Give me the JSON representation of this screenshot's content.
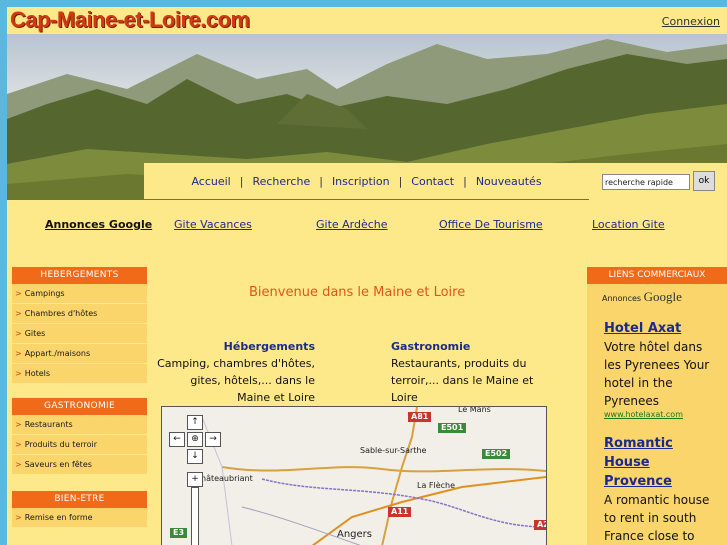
{
  "header": {
    "logo": "Cap-Maine-et-Loire.com",
    "login": "Connexion"
  },
  "nav": {
    "items": [
      "Accueil",
      "Recherche",
      "Inscription",
      "Contact",
      "Nouveautés"
    ],
    "separator": "|"
  },
  "search": {
    "placeholder": "recherche rapide",
    "button": "ok"
  },
  "google_links": {
    "label": "Annonces Google",
    "links": [
      "Gite Vacances",
      "Gite Ardèche",
      "Office De Tourisme",
      "Location Gite"
    ]
  },
  "sidebar": {
    "hebergements": {
      "title": "HEBERGEMENTS",
      "items": [
        "Campings",
        "Chambres d'hôtes",
        "Gites",
        "Appart./maisons",
        "Hotels"
      ]
    },
    "gastronomie": {
      "title": "GASTRONOMIE",
      "items": [
        "Restaurants",
        "Produits du terroir",
        "Saveurs en fêtes"
      ]
    },
    "bienetre": {
      "title": "BIEN-ETRE",
      "items": [
        "Remise en forme"
      ]
    },
    "arrow": ">"
  },
  "main": {
    "welcome": "Bienvenue dans le Maine et Loire",
    "col1": {
      "title": "Hébergements",
      "text": "Camping, chambres d'hôtes, gites, hôtels,... dans le Maine et Loire"
    },
    "col2": {
      "title": "Gastronomie",
      "text": "Restaurants, produits du terroir,... dans le Maine et Loire"
    }
  },
  "map": {
    "towns": [
      "Le Mans",
      "Sable-sur-Sarthe",
      "hâteaubriant",
      "La Flèche",
      "Angers"
    ],
    "roads": [
      "A81",
      "E501",
      "E502",
      "A11",
      "E3",
      "A2"
    ],
    "controls": {
      "up": "↑",
      "left": "←",
      "center": "⊕",
      "right": "→",
      "down": "↓",
      "zoom_in": "+"
    }
  },
  "right_sidebar": {
    "title": "LIENS COMMERCIAUX",
    "ads_by": "Annonces",
    "google": "Google",
    "ads": [
      {
        "title": "Hotel Axat",
        "body": "Votre hôtel dans les Pyrenees Your hotel in the Pyrenees",
        "url": "www.hotelaxat.com"
      },
      {
        "title": "Romantic House Provence",
        "body": "A romantic house to rent in south France close to"
      }
    ]
  },
  "colors": {
    "background": "#5ab7dd",
    "page": "#fde98a",
    "accent": "#f06a1a",
    "link": "#1d2a8c"
  }
}
